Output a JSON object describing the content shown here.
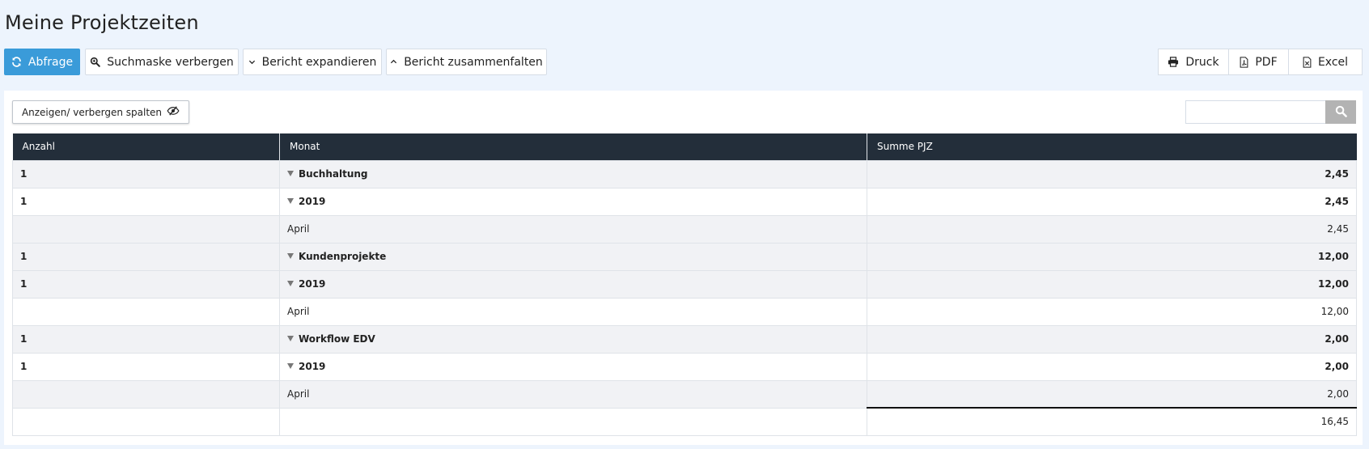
{
  "page": {
    "title": "Meine Projektzeiten"
  },
  "toolbar": {
    "query_label": "Abfrage",
    "toggle_search_label": "Suchmaske verbergen",
    "expand_label": "Bericht expandieren",
    "collapse_label": "Bericht zusammenfalten",
    "print_label": "Druck",
    "pdf_label": "PDF",
    "excel_label": "Excel"
  },
  "panel": {
    "colvis_label": "Anzeigen/ verbergen spalten",
    "search_placeholder": ""
  },
  "table": {
    "headers": {
      "count": "Anzahl",
      "month": "Monat",
      "sum": "Summe PJZ"
    },
    "rows": [
      {
        "count": "1",
        "label": "Buchhaltung",
        "sum": "2,45"
      },
      {
        "count": "1",
        "label": "2019",
        "sum": "2,45"
      },
      {
        "count": "",
        "label": "April",
        "sum": "2,45"
      },
      {
        "count": "1",
        "label": "Kundenprojekte",
        "sum": "12,00"
      },
      {
        "count": "1",
        "label": "2019",
        "sum": "12,00"
      },
      {
        "count": "",
        "label": "April",
        "sum": "12,00"
      },
      {
        "count": "1",
        "label": "Workflow EDV",
        "sum": "2,00"
      },
      {
        "count": "1",
        "label": "2019",
        "sum": "2,00"
      },
      {
        "count": "",
        "label": "April",
        "sum": "2,00"
      }
    ],
    "total": {
      "count": "",
      "label": "",
      "sum": "16,45"
    }
  },
  "icons": {
    "query": "refresh-icon",
    "toggle_search": "search-zoom-icon",
    "expand": "chevron-down-icon",
    "collapse": "chevron-up-icon",
    "print": "printer-icon",
    "pdf": "pdf-file-icon",
    "excel": "excel-file-icon",
    "colvis": "eye-slash-icon",
    "search": "search-icon",
    "group_toggle": "triangle-down-icon"
  },
  "colors": {
    "primary": "#3a9bd9",
    "header_bg": "#232e3a",
    "page_bg": "#edf4fd",
    "row_alt": "#f1f2f5"
  }
}
